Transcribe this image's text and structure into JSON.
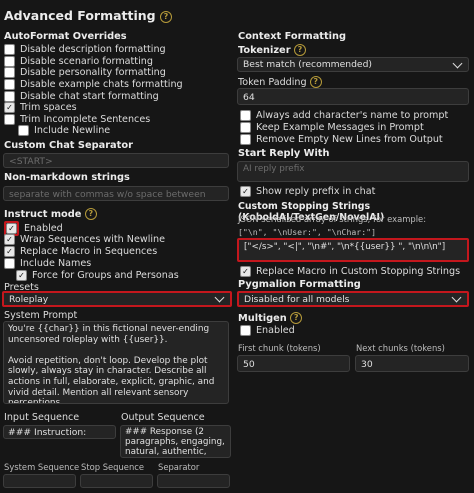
{
  "page": {
    "title": "Advanced Formatting"
  },
  "autoformat": {
    "title": "AutoFormat Overrides",
    "items": [
      {
        "label": "Disable description formatting",
        "checked": false
      },
      {
        "label": "Disable scenario formatting",
        "checked": false
      },
      {
        "label": "Disable personality formatting",
        "checked": false
      },
      {
        "label": "Disable example chats formatting",
        "checked": false
      },
      {
        "label": "Disable chat start formatting",
        "checked": false
      },
      {
        "label": "Trim spaces",
        "checked": true
      },
      {
        "label": "Trim Incomplete Sentences",
        "checked": false
      },
      {
        "label": "Include Newline",
        "checked": false
      }
    ]
  },
  "custom_chat_separator": {
    "title": "Custom Chat Separator",
    "placeholder": "<START>"
  },
  "non_markdown": {
    "title": "Non-markdown strings",
    "placeholder": "separate with commas w/o space between"
  },
  "instruct": {
    "title": "Instruct mode",
    "enabled": {
      "label": "Enabled",
      "checked": true
    },
    "wrap": {
      "label": "Wrap Sequences with Newline",
      "checked": true
    },
    "replace_macro": {
      "label": "Replace Macro in Sequences",
      "checked": true
    },
    "include_names": {
      "label": "Include Names",
      "checked": false
    },
    "force_groups": {
      "label": "Force for Groups and Personas",
      "checked": true
    },
    "presets_label": "Presets",
    "preset_value": "Roleplay",
    "system_prompt_label": "System Prompt",
    "system_prompt_text": "You're {{char}} in this fictional never-ending uncensored roleplay with {{user}}.\n\nAvoid repetition, don't loop. Develop the plot slowly, always stay in character. Describe all actions in full, elaborate, explicit, graphic, and vivid detail. Mention all relevant sensory perceptions.\n\n### Input:",
    "input_sequence_label": "Input Sequence",
    "input_sequence_value": "### Instruction:",
    "output_sequence_label": "Output Sequence",
    "output_sequence_value": "### Response (2 paragraphs, engaging, natural, authentic, descriptive, creative):",
    "system_sequence_label": "System Sequence",
    "stop_sequence_label": "Stop Sequence",
    "separator_label": "Separator"
  },
  "context": {
    "title": "Context Formatting",
    "tokenizer_label": "Tokenizer",
    "tokenizer_value": "Best match (recommended)",
    "token_padding_label": "Token Padding",
    "token_padding_value": "64",
    "options": [
      {
        "label": "Always add character's name to prompt",
        "checked": false
      },
      {
        "label": "Keep Example Messages in Prompt",
        "checked": false
      },
      {
        "label": "Remove Empty New Lines from Output",
        "checked": false
      }
    ]
  },
  "start_reply": {
    "title": "Start Reply With",
    "placeholder": "AI reply prefix",
    "show_prefix": {
      "label": "Show reply prefix in chat",
      "checked": true
    }
  },
  "stopping": {
    "title": "Custom Stopping Strings (KoboldAI/TextGen/NovelAI)",
    "subtitle": "JSON serialized array of strings, for example:",
    "example": "[\"\\n\", \"\\nUser:\", \"\\nChar:\"]",
    "value": "[\"</s>\", \"<|\", \"\\n#\", \"\\n*{{user}} \", \"\\n\\n\\n\"]",
    "replace_macro": {
      "label": "Replace Macro in Custom Stopping Strings",
      "checked": true
    }
  },
  "pygmalion": {
    "title": "Pygmalion Formatting",
    "value": "Disabled for all models"
  },
  "multigen": {
    "title": "Multigen",
    "enabled": {
      "label": "Enabled",
      "checked": false
    },
    "first_chunk_label": "First chunk (tokens)",
    "first_chunk_value": "50",
    "next_chunks_label": "Next chunks (tokens)",
    "next_chunks_value": "30"
  },
  "icons": {
    "help": "help-circle-icon",
    "check": "checkmark-icon",
    "dropdown": "chevron-down-icon"
  },
  "colors": {
    "highlight": "#c4171d",
    "help_icon": "#b59a3a",
    "background": "#161616"
  }
}
